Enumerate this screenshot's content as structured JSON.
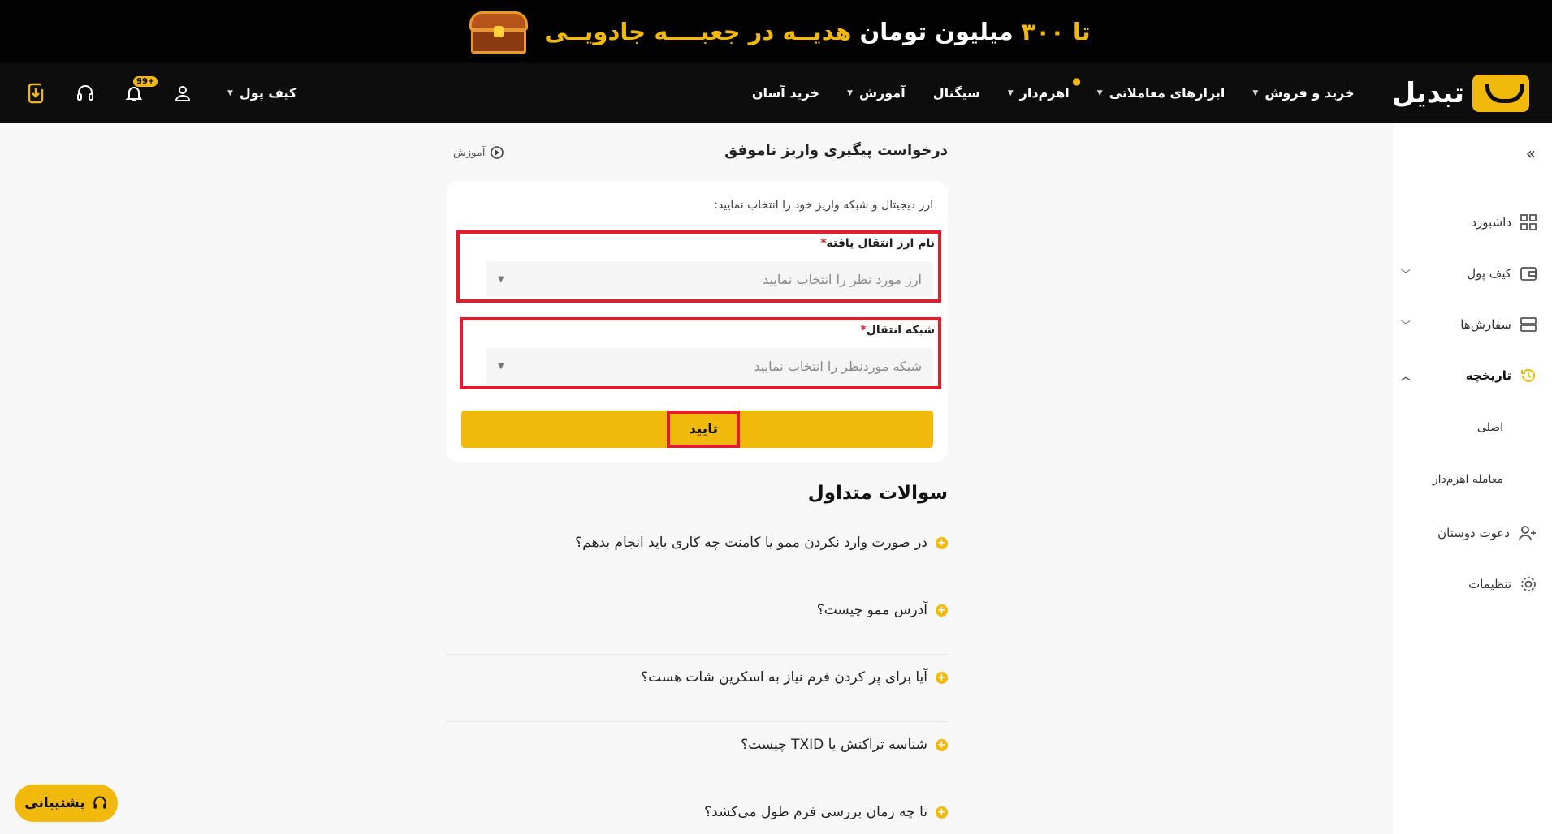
{
  "promo": {
    "part1": "تا ۳۰۰",
    "part2": "میلیون تومان",
    "part3": "هدیــه در جعبــــه جادویــی"
  },
  "brand": {
    "name": "تبدیل"
  },
  "nav": {
    "items": [
      {
        "label": "خرید و فروش",
        "has_caret": true
      },
      {
        "label": "ابزارهای معاملاتی",
        "has_caret": true
      },
      {
        "label": "اهرم‌دار",
        "has_caret": true
      },
      {
        "label": "سیگنال",
        "has_caret": false
      },
      {
        "label": "آموزش",
        "has_caret": true
      },
      {
        "label": "خرید آسان",
        "has_caret": false
      }
    ],
    "wallet_label": "کیف پول",
    "notification_badge": "99+"
  },
  "sidebar": {
    "items": [
      {
        "label": "داشبورد",
        "icon": "grid-icon"
      },
      {
        "label": "کیف پول",
        "icon": "wallet-icon"
      },
      {
        "label": "سفارش‌ها",
        "icon": "orders-icon"
      },
      {
        "label": "تاریخچه",
        "icon": "history-icon"
      },
      {
        "label": "دعوت دوستان",
        "icon": "add-user-icon"
      },
      {
        "label": "تنظیمات",
        "icon": "gear-icon"
      }
    ],
    "sub_items": [
      "اصلی",
      "معامله اهرم‌دار"
    ]
  },
  "page": {
    "title": "درخواست پیگیری واریز ناموفق",
    "tutorial_label": "آموزش",
    "hint": "ارز دیجیتال و شبکه واریز خود را انتخاب نمایید:",
    "currency_label": "نام ارز انتقال یافته",
    "currency_placeholder": "ارز مورد نظر را انتخاب نمایید",
    "network_label": "شبکه انتقال",
    "network_placeholder": "شبکه موردنظر را انتخاب نمایید",
    "required_mark": "*",
    "submit_label": "تایید"
  },
  "faq": {
    "title": "سوالات متداول",
    "items": [
      "در صورت وارد نکردن ممو یا کامنت چه کاری باید انجام بدهم؟",
      "آدرس ممو چیست؟",
      "آیا برای پر کردن فرم نیاز به اسکرین شات هست؟",
      "شناسه تراکنش یا TXID چیست؟",
      "تا چه زمان بررسی فرم طول می‌کشد؟"
    ]
  },
  "support": {
    "label": "پشتیبانی"
  },
  "colors": {
    "accent": "#f0b90b",
    "highlight": "#e21c2a",
    "nav_bg": "#0d0d0d"
  }
}
